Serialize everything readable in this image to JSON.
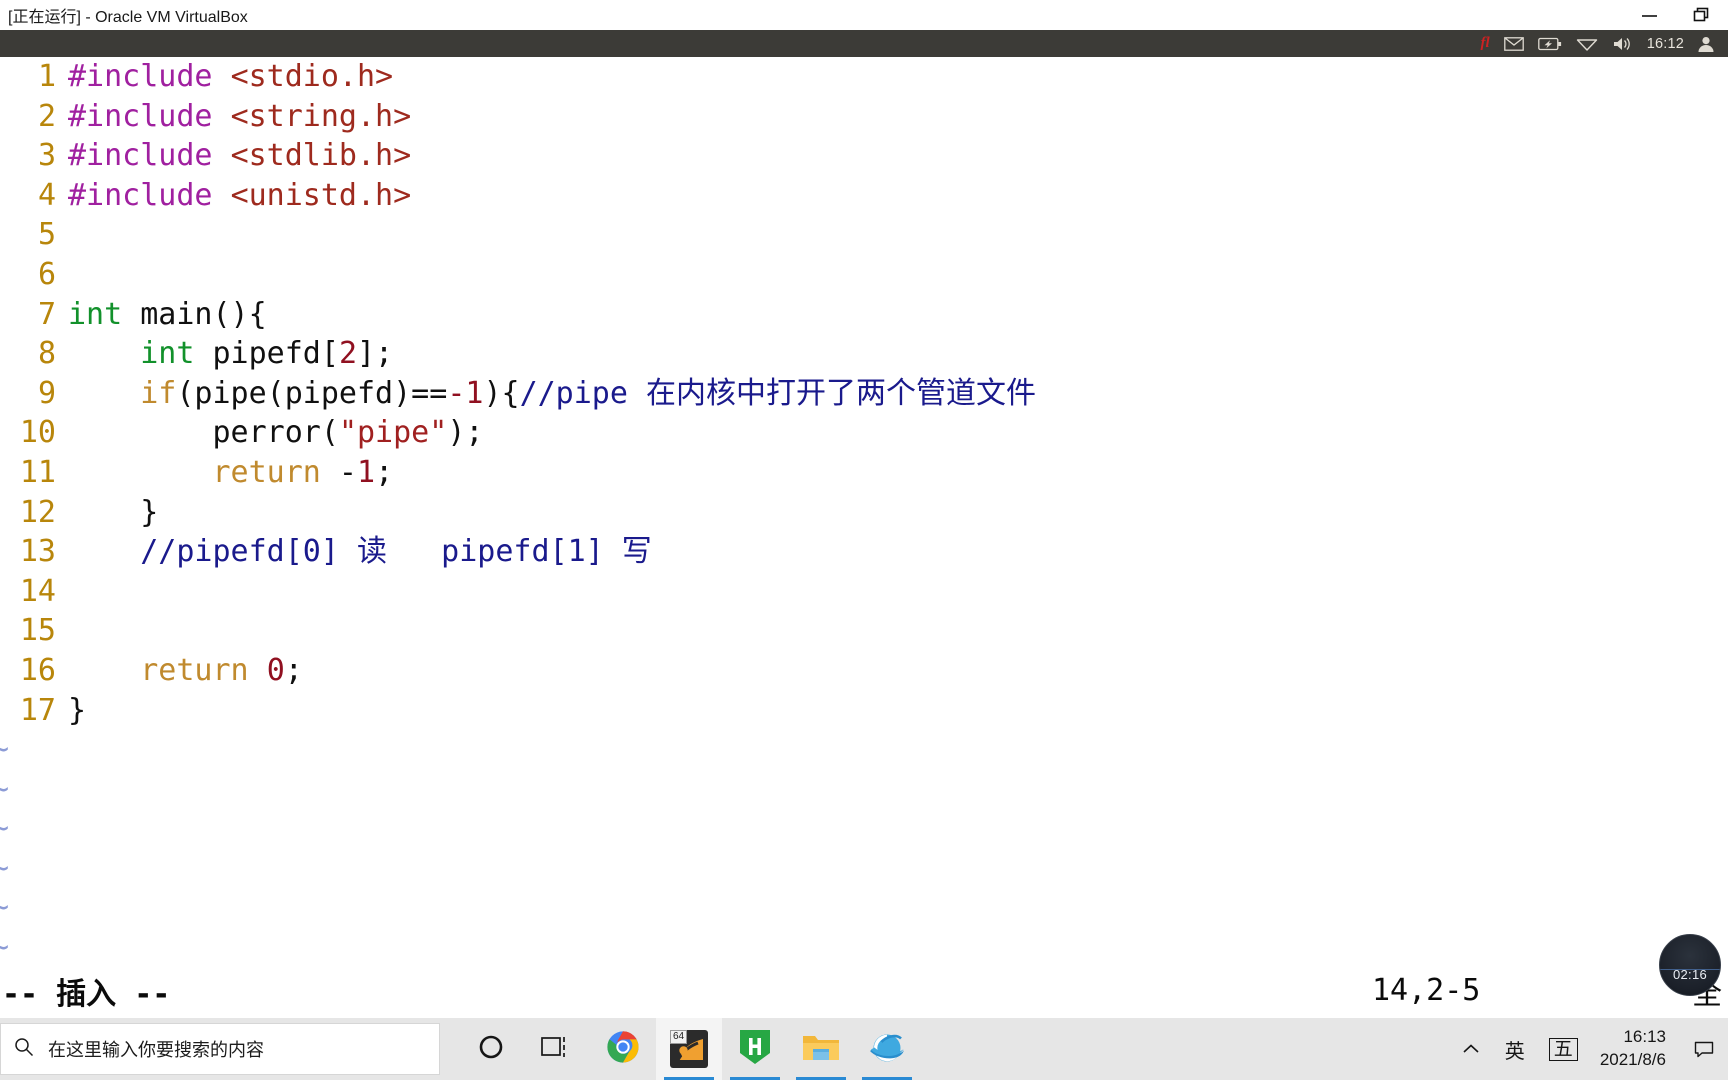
{
  "host_window": {
    "title": "[正在运行] - Oracle VM VirtualBox",
    "controls": [
      {
        "name": "minimize",
        "glyph": "minimize-icon"
      },
      {
        "name": "restore",
        "glyph": "restore-icon"
      }
    ]
  },
  "guest_panel": {
    "background": "#3c3b37",
    "fcitx_label": "fl",
    "items": [
      "fcitx-icon",
      "mail-icon",
      "battery-icon",
      "wifi-icon",
      "volume-icon"
    ],
    "clock": "16:12",
    "user_icon": "user-icon"
  },
  "editor": {
    "app": "vim",
    "background": "#ffffff",
    "colors": {
      "linenumber": "#b8860b",
      "preprocessor": "#a020a0",
      "header": "#9e2a1e",
      "type": "#12912b",
      "statement": "#c08a2e",
      "number": "#901020",
      "string": "#a02020",
      "comment": "#1a1a8c",
      "plain": "#101010",
      "tilde": "#8c9bd6"
    },
    "lines": [
      {
        "n": "1",
        "tokens": [
          {
            "t": "pre",
            "v": "#include "
          },
          {
            "t": "hdr",
            "v": "<stdio.h>"
          }
        ]
      },
      {
        "n": "2",
        "tokens": [
          {
            "t": "pre",
            "v": "#include "
          },
          {
            "t": "hdr",
            "v": "<string.h>"
          }
        ]
      },
      {
        "n": "3",
        "tokens": [
          {
            "t": "pre",
            "v": "#include "
          },
          {
            "t": "hdr",
            "v": "<stdlib.h>"
          }
        ]
      },
      {
        "n": "4",
        "tokens": [
          {
            "t": "pre",
            "v": "#include "
          },
          {
            "t": "hdr",
            "v": "<unistd.h>"
          }
        ]
      },
      {
        "n": "5",
        "tokens": []
      },
      {
        "n": "6",
        "tokens": []
      },
      {
        "n": "7",
        "tokens": [
          {
            "t": "type",
            "v": "int"
          },
          {
            "t": "plain",
            "v": " main(){"
          }
        ]
      },
      {
        "n": "8",
        "tokens": [
          {
            "t": "plain",
            "v": "    "
          },
          {
            "t": "type",
            "v": "int"
          },
          {
            "t": "plain",
            "v": " pipefd["
          },
          {
            "t": "num",
            "v": "2"
          },
          {
            "t": "plain",
            "v": "];"
          }
        ]
      },
      {
        "n": "9",
        "tokens": [
          {
            "t": "plain",
            "v": "    "
          },
          {
            "t": "stmt",
            "v": "if"
          },
          {
            "t": "plain",
            "v": "(pipe(pipefd)=="
          },
          {
            "t": "num",
            "v": "-1"
          },
          {
            "t": "plain",
            "v": "){"
          },
          {
            "t": "cmt",
            "v": "//pipe 在内核中打开了两个管道文件"
          }
        ]
      },
      {
        "n": "10",
        "tokens": [
          {
            "t": "plain",
            "v": "        perror("
          },
          {
            "t": "str",
            "v": "\"pipe\""
          },
          {
            "t": "plain",
            "v": ");"
          }
        ]
      },
      {
        "n": "11",
        "tokens": [
          {
            "t": "plain",
            "v": "        "
          },
          {
            "t": "stmt",
            "v": "return"
          },
          {
            "t": "plain",
            "v": " -"
          },
          {
            "t": "num",
            "v": "1"
          },
          {
            "t": "plain",
            "v": ";"
          }
        ]
      },
      {
        "n": "12",
        "tokens": [
          {
            "t": "plain",
            "v": "    }"
          }
        ]
      },
      {
        "n": "13",
        "tokens": [
          {
            "t": "plain",
            "v": "    "
          },
          {
            "t": "cmt",
            "v": "//pipefd[0] 读   pipefd[1] 写"
          }
        ]
      },
      {
        "n": "14",
        "tokens": []
      },
      {
        "n": "15",
        "tokens": []
      },
      {
        "n": "16",
        "tokens": [
          {
            "t": "plain",
            "v": "    "
          },
          {
            "t": "stmt",
            "v": "return"
          },
          {
            "t": "plain",
            "v": " "
          },
          {
            "t": "num",
            "v": "0"
          },
          {
            "t": "plain",
            "v": ";"
          }
        ]
      },
      {
        "n": "17",
        "tokens": [
          {
            "t": "plain",
            "v": "}"
          }
        ]
      }
    ],
    "empty_marker": "~",
    "empty_marker_count": 7
  },
  "status_line": {
    "mode": "-- 插入 --",
    "ruler": "14,2-5",
    "file_position": "全"
  },
  "recorder": {
    "elapsed": "02:16"
  },
  "taskbar": {
    "background": "#e6e6e6",
    "start_icon": "windows-start-icon",
    "search": {
      "placeholder": "在这里输入你要搜索的内容",
      "icon": "search-icon"
    },
    "items": [
      {
        "name": "cortana",
        "icon": "cortana-icon",
        "active": false,
        "running": false
      },
      {
        "name": "task-view",
        "icon": "task-view-icon",
        "active": false,
        "running": false
      },
      {
        "name": "google-chrome",
        "icon": "chrome-icon",
        "active": false,
        "running": false
      },
      {
        "name": "virtualbox",
        "icon": "virtualbox-icon",
        "active": true,
        "running": true,
        "badge": "64"
      },
      {
        "name": "hbuilder",
        "icon": "hbuilder-icon",
        "active": false,
        "running": true
      },
      {
        "name": "file-explorer",
        "icon": "folder-icon",
        "active": false,
        "running": true
      },
      {
        "name": "internet-explorer",
        "icon": "ie-icon",
        "active": false,
        "running": true
      }
    ],
    "tray": {
      "overflow_icon": "chevron-up-icon",
      "ime_language": "英",
      "ime_mode": "五",
      "time": "16:13",
      "date": "2021/8/6",
      "notification_icon": "notification-icon"
    }
  }
}
